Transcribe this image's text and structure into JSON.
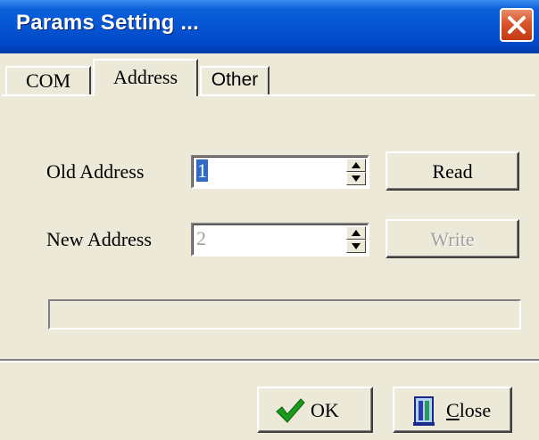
{
  "window": {
    "title": "Params Setting ..."
  },
  "tabs": [
    {
      "label": "COM",
      "active": false
    },
    {
      "label": "Address",
      "active": true
    },
    {
      "label": "Other",
      "active": false
    }
  ],
  "form": {
    "old_address_label": "Old Address",
    "old_address_value": "1",
    "new_address_label": "New Address",
    "new_address_value": "2",
    "read_label": "Read",
    "write_label": "Write"
  },
  "progress": {
    "value": 0
  },
  "footer": {
    "ok_label": "OK",
    "close_label_first": "C",
    "close_label_rest": "lose"
  },
  "colors": {
    "titlebar": "#0555d4",
    "face": "#ece9d8",
    "selection": "#316ac5",
    "ok_check": "#1a9a1a"
  }
}
